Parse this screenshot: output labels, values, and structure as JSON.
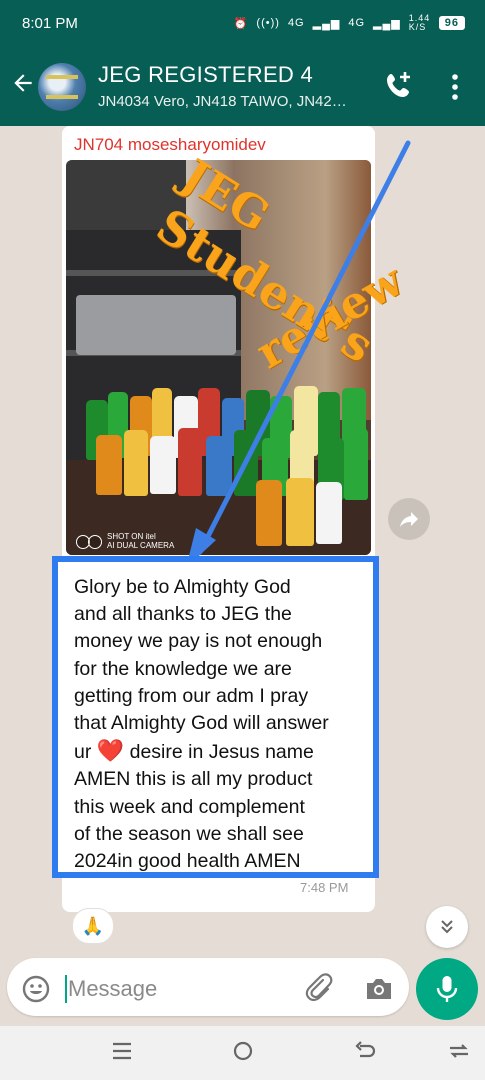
{
  "status_bar": {
    "time": "8:01 PM",
    "network_1": "4G",
    "network_2": "4G",
    "speed": "1.44 K/S",
    "battery": "96"
  },
  "header": {
    "title": "JEG REGISTERED 4",
    "subtitle": "JN4034 Vero, JN418 TAIWO, JN42…",
    "icons": [
      "back-arrow-icon",
      "add-call-icon",
      "more-vert-icon"
    ]
  },
  "message": {
    "sender": "JN704 mosesharyomidev",
    "image_caption": "SHOT ON itel\nAI DUAL CAMERA",
    "watermark_lines": [
      "JEG",
      "Student's",
      "review"
    ],
    "text_lines": [
      "Glory be to Almighty God",
      "and all thanks to JEG  the",
      "money we pay is not enough",
      "for the knowledge we are",
      "getting from our adm I pray",
      "that Almighty God will answer",
      "ur",
      "desire in Jesus name",
      "AMEN this is all my product",
      "this week and complement",
      "of the season we shall see",
      "2024in good health AMEN"
    ],
    "heart": "❤️",
    "time": "7:48 PM",
    "reaction": "🙏"
  },
  "composer": {
    "placeholder": "Message"
  },
  "colors": {
    "header": "#075e54",
    "accent": "#00a884",
    "highlight_box": "#2f7bf0",
    "sender": "#e0332d",
    "watermark": "#f9a41a"
  }
}
